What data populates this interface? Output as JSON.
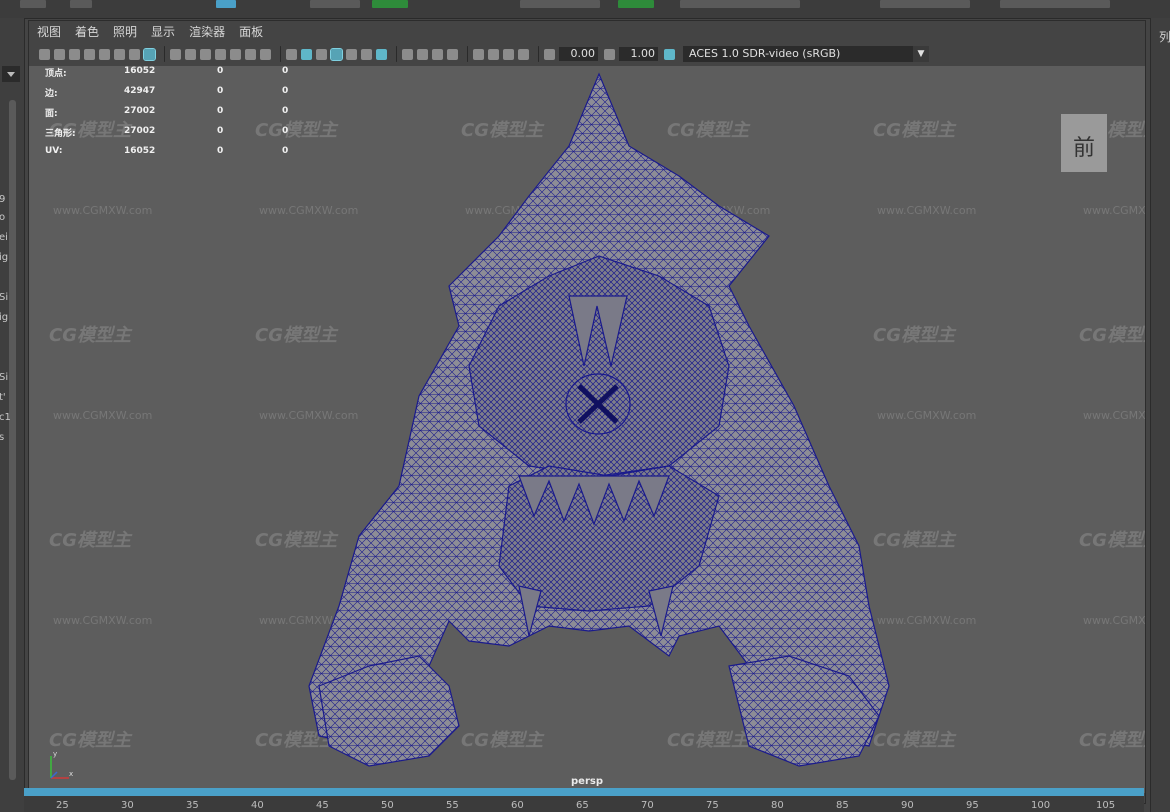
{
  "menu": [
    "视图",
    "着色",
    "照明",
    "显示",
    "渲染器",
    "面板"
  ],
  "toolbar": {
    "exposure_value": "0.00",
    "gamma_value": "1.00",
    "color_space": "ACES 1.0 SDR-video (sRGB)"
  },
  "hud": [
    {
      "label": "顶点:",
      "v1": "16052",
      "v2": "0",
      "v3": "0"
    },
    {
      "label": "边:",
      "v1": "42947",
      "v2": "0",
      "v3": "0"
    },
    {
      "label": "面:",
      "v1": "27002",
      "v2": "0",
      "v3": "0"
    },
    {
      "label": "三角形:",
      "v1": "27002",
      "v2": "0",
      "v3": "0"
    },
    {
      "label": "UV:",
      "v1": "16052",
      "v2": "0",
      "v3": "0"
    }
  ],
  "viewcube_label": "前",
  "camera_label": "persp",
  "watermark_logo": "CG模型主",
  "watermark_url": "www.CGMXW.com",
  "right_panel_label": "列",
  "left_panel_fragments": [
    "9",
    "o",
    "ei",
    "ig",
    "Si",
    "ig",
    "Si",
    "t'",
    "c1",
    "s"
  ],
  "timeline_ticks": [
    "25",
    "30",
    "35",
    "40",
    "45",
    "50",
    "55",
    "60",
    "65",
    "70",
    "75",
    "80",
    "85",
    "90",
    "95",
    "100",
    "105"
  ],
  "colors": {
    "wire": "#1a1a8c",
    "mesh": "#8c8c94",
    "viewport_bg": "#5d5d5d",
    "timeline": "#4aa0c8"
  }
}
